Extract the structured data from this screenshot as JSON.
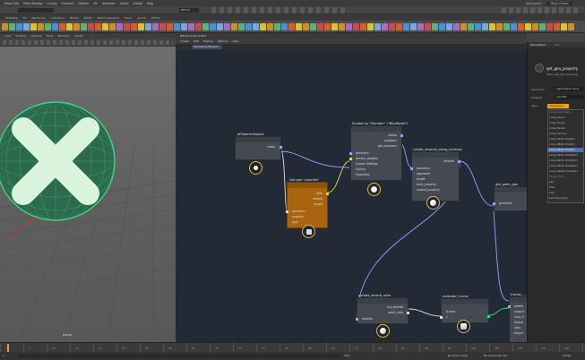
{
  "menubar": {
    "items": [
      "Show Grid",
      "Mesh Display",
      "Curves",
      "Surfaces",
      "Deform",
      "UV",
      "Generate",
      "Cache",
      "Arnold",
      "Help"
    ],
    "workspace_label": "Workspace:",
    "workspace_value": "Maya Classic"
  },
  "statusline": {
    "camera_field": "Bifrost"
  },
  "shelf": {
    "tabs": [
      "Modeling",
      "FX",
      "Rendering",
      "Animation",
      "Bifrost",
      "MASH",
      "Motion Graphics",
      "XGen",
      "Arnold",
      "Bifrost"
    ]
  },
  "viewport": {
    "menu": [
      "View",
      "Shading",
      "Lighting",
      "Show",
      "Renderer",
      "Panels"
    ],
    "camera_label": "persp",
    "colors": {
      "wire": "#3fe08a",
      "sphere_fill": "#2d6a4d",
      "x_glow": "#e8ffe9"
    }
  },
  "bifrost": {
    "window_title": "Bifrost Graph Editor",
    "menu": [
      "Create",
      "Edit",
      "Display",
      "Options",
      "Help"
    ],
    "tab": "bifrostGraphShape1",
    "nodes": {
      "platonic": {
        "title": "pPlatonicShape1",
        "out": "mesh"
      },
      "scatter": {
        "title": "Scatter by \"Number\" (\"BlueNoise\")",
        "inputs": [
          "geometry",
          "density_weights",
          "Scatter Settings",
          "Culling",
          "Properties"
        ],
        "outputs": [
          "points",
          "positions",
          "geo_locations"
        ]
      },
      "getgeo": {
        "title": "Get geo \"colorSet\"",
        "inputs": [
          "geometry",
          "property",
          "type"
        ],
        "outputs": [
          "data",
          "default",
          "target"
        ]
      },
      "strands": {
        "title": "create_strands_along_normals",
        "inputs": [
          "geometry",
          "segments",
          "length",
          "start_property",
          "normal_property"
        ],
        "outputs": [
          "strands"
        ]
      },
      "getpoint": {
        "title": "get_point_pos",
        "inputs": [
          "geometry"
        ]
      },
      "ratio": {
        "title": "update_strand_ratio",
        "inputs": [
          "strands"
        ],
        "outputs": [
          "out_strands",
          "point_ratio"
        ]
      },
      "fcurve": {
        "title": "evaluate_fcurve",
        "inputs": [
          "fcurve",
          "x"
        ]
      },
      "fractal": {
        "title": "fractal_...",
        "inputs": [
          "positio",
          "magnit",
          "num_fr",
          "freque",
          "ratio",
          "freque"
        ]
      }
    }
  },
  "right_panel": {
    "tabs": [
      "Parameters",
      "Info"
    ],
    "node_title": "get_geo_property",
    "node_type": "Type: get_geo_property",
    "fields": [
      {
        "label": "Geometry",
        "value": "pgmShape1 Input"
      },
      {
        "label": "Property",
        "value": "colorSet"
      },
      {
        "label": "Type",
        "value": "Unresolved Type"
      }
    ],
    "type_options": [
      "Unresolved Type",
      "array<bool>",
      "array<long>",
      "array<float>",
      "array<string>",
      "array<Math::float2>",
      "array<Math::float3>",
      "array<Math::float4>",
      "array<Math::float2x2>",
      "array<Math::float3x3>",
      "array<Math::float4x4>",
      "array<Math::double3>",
      "Object Type",
      "uint",
      "float",
      "bool",
      "Set Value Type..."
    ],
    "highlighted_option": "array<Math::float3>"
  },
  "timeline": {
    "ticks": [
      "1",
      "5",
      "10",
      "15",
      "20",
      "25",
      "30",
      "35",
      "40",
      "45",
      "50",
      "55",
      "60",
      "65",
      "70",
      "75",
      "80",
      "85",
      "90",
      "95",
      "100",
      "105",
      "110",
      "115",
      "120"
    ]
  },
  "rangebar": {
    "start": "1",
    "end": "120",
    "anim_layer": "No Anim Layer",
    "character_set": "No Character Set",
    "fps": "24 fps"
  }
}
